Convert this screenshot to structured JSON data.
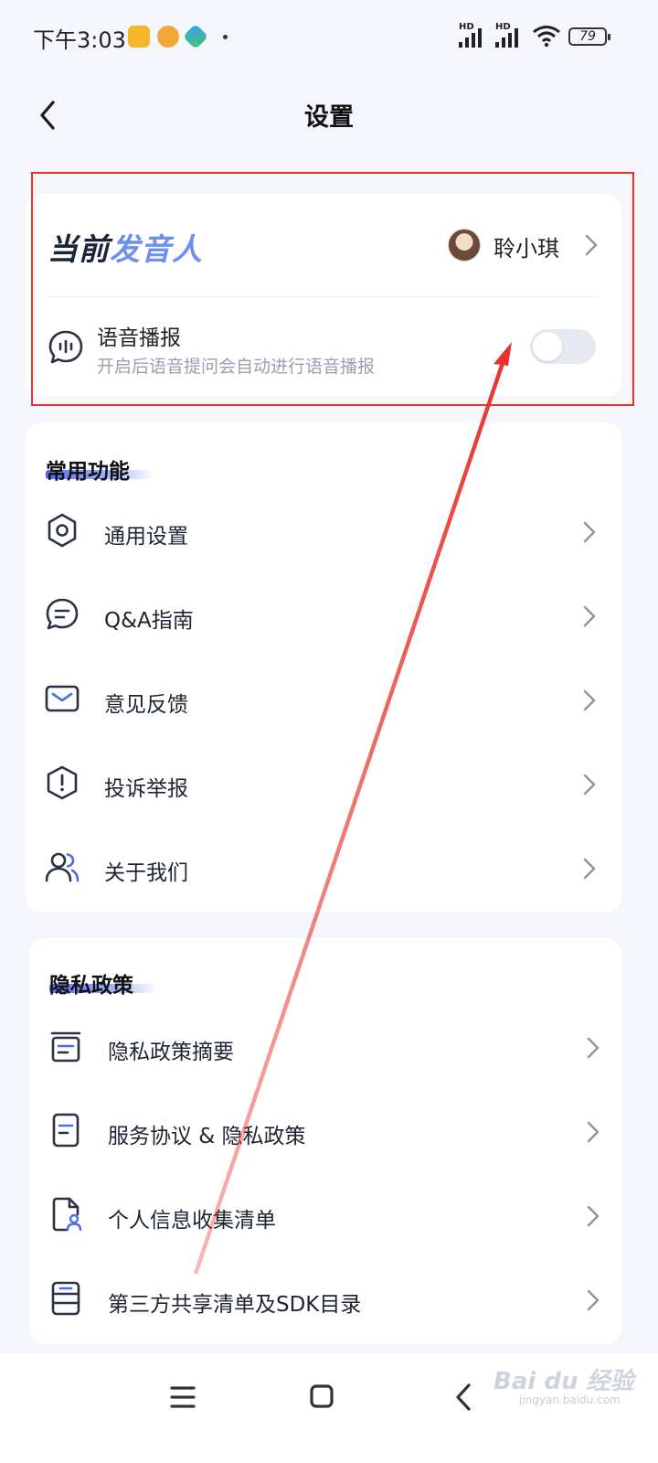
{
  "status_bar": {
    "time": "下午3:03",
    "hd1": "HD",
    "hd2": "HD",
    "battery": "79"
  },
  "header": {
    "title": "设置"
  },
  "speaker": {
    "title_part1": "当前",
    "title_part2": "发音人",
    "name": "聆小琪"
  },
  "voice_broadcast": {
    "label": "语音播报",
    "description": "开启后语音提问会自动进行语音播报",
    "enabled": false
  },
  "common": {
    "title": "常用功能",
    "items": [
      {
        "label": "通用设置",
        "icon": "gear-icon"
      },
      {
        "label": "Q&A指南",
        "icon": "chat-bubble-icon"
      },
      {
        "label": "意见反馈",
        "icon": "mail-icon"
      },
      {
        "label": "投诉举报",
        "icon": "alert-shield-icon"
      },
      {
        "label": "关于我们",
        "icon": "users-icon"
      }
    ]
  },
  "privacy": {
    "title": "隐私政策",
    "items": [
      {
        "label": "隐私政策摘要",
        "icon": "summary-icon"
      },
      {
        "label": "服务协议 & 隐私政策",
        "icon": "document-icon"
      },
      {
        "label": "个人信息收集清单",
        "icon": "personal-file-icon"
      },
      {
        "label": "第三方共享清单及SDK目录",
        "icon": "database-icon"
      }
    ]
  },
  "watermark": {
    "text": "Bai du 经验",
    "sub": "jingyan.baidu.com"
  },
  "colors": {
    "accent": "#4e6be8",
    "annotation": "#e8322c",
    "background": "#f4f6fb"
  }
}
